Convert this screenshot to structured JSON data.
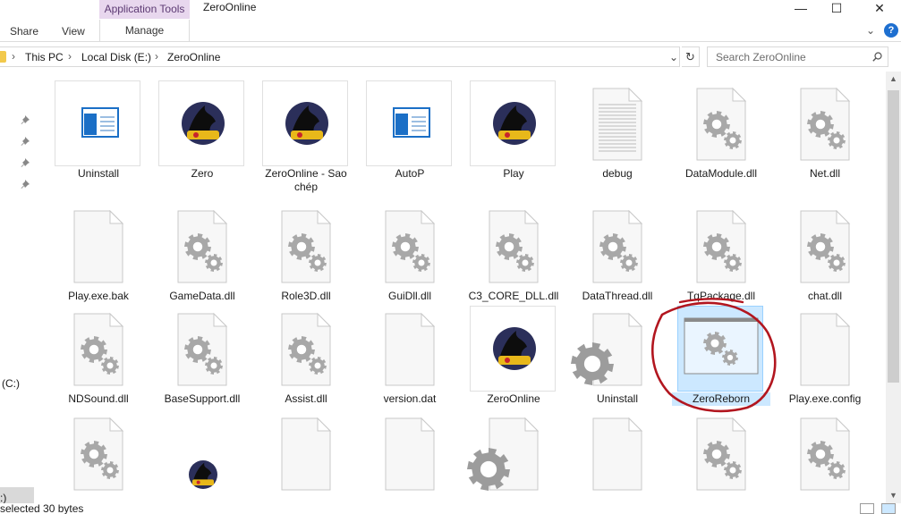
{
  "window": {
    "title": "ZeroOnline",
    "context_tab": "Application Tools",
    "controls": {
      "minimize": "—",
      "maximize": "☐",
      "close": "✕"
    }
  },
  "ribbon": {
    "tabs": [
      "Share",
      "View"
    ],
    "manage": "Manage",
    "collapse_glyph": "⌄",
    "help_glyph": "?"
  },
  "address": {
    "crumbs": [
      "This PC",
      "Local Disk (E:)",
      "ZeroOnline"
    ],
    "separator": "›",
    "dropdown_glyph": "⌄",
    "refresh_glyph": "↻"
  },
  "search": {
    "placeholder": "Search ZeroOnline"
  },
  "nav": {
    "items": [
      "(C:)",
      ":)"
    ]
  },
  "files": [
    {
      "name": "Uninstall",
      "icon": "app-window-icon"
    },
    {
      "name": "Zero",
      "icon": "game-logo-icon"
    },
    {
      "name": "ZeroOnline - Sao chép",
      "icon": "game-logo-icon"
    },
    {
      "name": "AutoP",
      "icon": "app-window-icon"
    },
    {
      "name": "Play",
      "icon": "game-logo-icon"
    },
    {
      "name": "debug",
      "icon": "text-document-icon"
    },
    {
      "name": "DataModule.dll",
      "icon": "dll-gear-icon"
    },
    {
      "name": "Net.dll",
      "icon": "dll-gear-icon"
    },
    {
      "name": "Play.exe.bak",
      "icon": "blank-file-icon"
    },
    {
      "name": "GameData.dll",
      "icon": "dll-gear-icon"
    },
    {
      "name": "Role3D.dll",
      "icon": "dll-gear-icon"
    },
    {
      "name": "GuiDll.dll",
      "icon": "dll-gear-icon"
    },
    {
      "name": "C3_CORE_DLL.dll",
      "icon": "dll-gear-icon"
    },
    {
      "name": "DataThread.dll",
      "icon": "dll-gear-icon"
    },
    {
      "name": "TqPackage.dll",
      "icon": "dll-gear-icon"
    },
    {
      "name": "chat.dll",
      "icon": "dll-gear-icon"
    },
    {
      "name": "NDSound.dll",
      "icon": "dll-gear-icon"
    },
    {
      "name": "BaseSupport.dll",
      "icon": "dll-gear-icon"
    },
    {
      "name": "Assist.dll",
      "icon": "dll-gear-icon"
    },
    {
      "name": "version.dat",
      "icon": "blank-file-icon"
    },
    {
      "name": "ZeroOnline",
      "icon": "game-logo-icon"
    },
    {
      "name": "Uninstall",
      "icon": "blank-file-gear-icon"
    },
    {
      "name": "ZeroReborn",
      "icon": "app-window-gear-icon",
      "selected": true
    },
    {
      "name": "Play.exe.config",
      "icon": "blank-file-icon"
    },
    {
      "name": "",
      "icon": "dll-gear-icon"
    },
    {
      "name": "",
      "icon": "game-logo-icon"
    },
    {
      "name": "",
      "icon": "blank-file-icon"
    },
    {
      "name": "",
      "icon": "blank-file-icon"
    },
    {
      "name": "",
      "icon": "blank-file-gear-icon"
    },
    {
      "name": "",
      "icon": "blank-file-icon"
    },
    {
      "name": "",
      "icon": "dll-gear-icon"
    },
    {
      "name": "",
      "icon": "dll-gear-icon"
    }
  ],
  "status": {
    "text": "selected  30 bytes"
  },
  "colors": {
    "selection_fill": "#cce8ff",
    "selection_border": "#99d1ff",
    "context_tab": "#e8d7ee",
    "annotation": "#b2161f",
    "gear": "#a8a8a8"
  }
}
